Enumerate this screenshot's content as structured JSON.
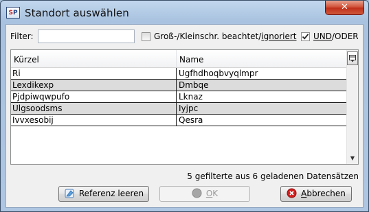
{
  "window": {
    "title": "Standort auswählen",
    "app_icon_text_a": "S",
    "app_icon_text_b": "P",
    "close_glyph": "✕"
  },
  "filter": {
    "label": "Filter:",
    "value": "",
    "placeholder": ""
  },
  "case_option": {
    "label_prefix": "Groß-/Kleinschr. beachtet/",
    "label_underlined": "ignoriert",
    "checked": false
  },
  "logic_option": {
    "label_underlined": "UND",
    "label_suffix": "/ODER",
    "checked": true
  },
  "grid": {
    "columns": [
      "Kürzel",
      "Name"
    ],
    "rows": [
      [
        "Ri",
        "Ugfhdhoqbvyqlmpr"
      ],
      [
        "Lexdikexp",
        "Dmbqe"
      ],
      [
        "Pjdpiwqwpufo",
        "Lknaz"
      ],
      [
        "Ulgsoodsms",
        "Iyjpc"
      ],
      [
        "Ivvxesobij",
        "Qesra"
      ]
    ],
    "corner_icon": "column-chooser-icon"
  },
  "status_text": "5 gefilterte aus 6 geladenen Datensätzen",
  "buttons": {
    "reset_label": "Referenz leeren",
    "ok_label": "OK",
    "ok_underlined": "O",
    "ok_rest": "K",
    "cancel_underlined": "A",
    "cancel_rest": "bbrechen"
  },
  "colors": {
    "alt_row": "#dcdcdc",
    "close_red": "#c0301b",
    "cancel_icon_red": "#d21f1f",
    "ok_icon_gray": "#9a9a9a"
  }
}
